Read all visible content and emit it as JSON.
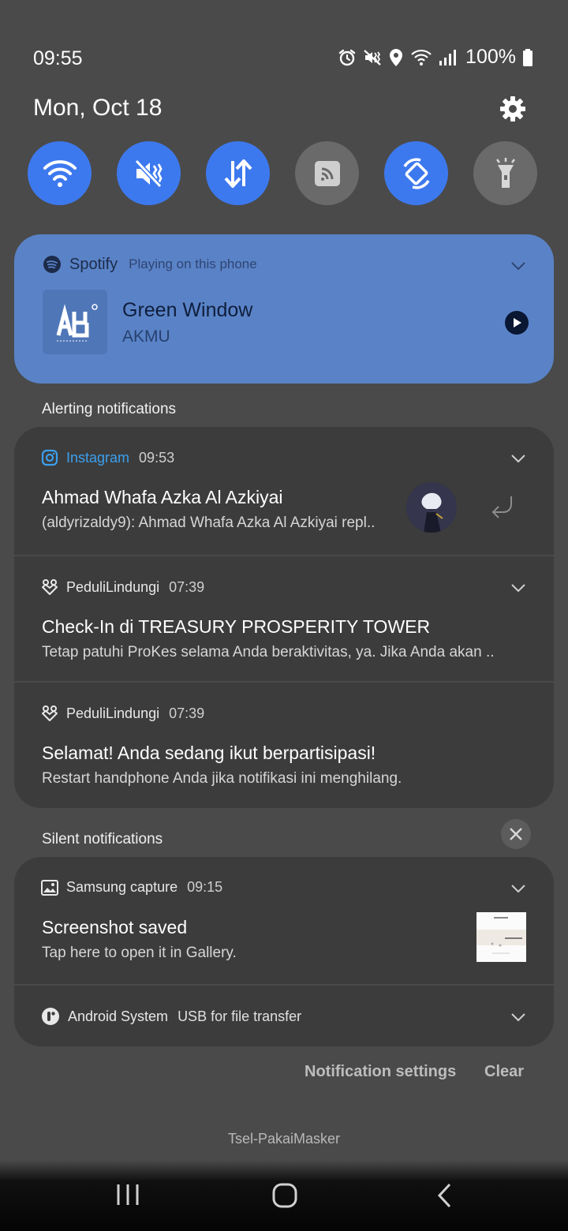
{
  "status_bar": {
    "time": "09:55",
    "battery": "100%",
    "icons": [
      "alarm-icon",
      "mute-vibrate-icon",
      "location-icon",
      "wifi-icon",
      "signal-icon",
      "battery-icon"
    ]
  },
  "header": {
    "date": "Mon, Oct 18",
    "settings_icon": "gear-icon"
  },
  "quick_settings": [
    {
      "name": "wifi",
      "state": "on"
    },
    {
      "name": "sound-mute",
      "state": "on"
    },
    {
      "name": "mobile-data",
      "state": "on"
    },
    {
      "name": "nfc-cast",
      "state": "off"
    },
    {
      "name": "auto-rotate",
      "state": "on"
    },
    {
      "name": "flashlight",
      "state": "off"
    }
  ],
  "media": {
    "app": "Spotify",
    "subtitle": "Playing on this phone",
    "song": "Green Window",
    "artist": "AKMU",
    "accent": "#5a83c7"
  },
  "alerting": {
    "title": "Alerting notifications",
    "items": [
      {
        "app": "Instagram",
        "time": "09:53",
        "title": "Ahmad Whafa Azka Al Azkiyai",
        "text": "(aldyrizaldy9): Ahmad Whafa Azka Al Azkiyai repl.."
      },
      {
        "app": "PeduliLindungi",
        "time": "07:39",
        "title": "Check-In di TREASURY PROSPERITY TOWER",
        "text": "Tetap patuhi ProKes selama Anda beraktivitas, ya. Jika Anda akan .."
      },
      {
        "app": "PeduliLindungi",
        "time": "07:39",
        "title": "Selamat! Anda sedang ikut berpartisipasi!",
        "text": "Restart handphone Anda jika notifikasi ini menghilang."
      }
    ]
  },
  "silent": {
    "title": "Silent notifications",
    "items": [
      {
        "app": "Samsung capture",
        "time": "09:15",
        "title": "Screenshot saved",
        "text": "Tap here to open it in Gallery."
      },
      {
        "app": "Android System",
        "text": "USB for file transfer"
      }
    ]
  },
  "footer": {
    "settings_label": "Notification settings",
    "clear_label": "Clear",
    "carrier": "Tsel-PakaiMasker"
  }
}
